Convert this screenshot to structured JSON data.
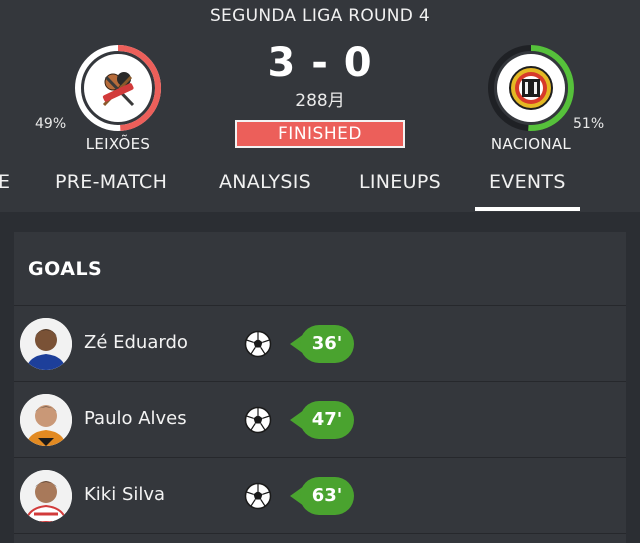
{
  "match": {
    "round": "SEGUNDA LIGA ROUND 4",
    "score": "3 - 0",
    "date": "288月",
    "status": "FINISHED"
  },
  "home": {
    "name": "LEIXÕES",
    "possession_label": "49%",
    "possession": 0.49,
    "ring_color": "#ec5f5a",
    "logo_icon": "leixoes-crest-icon"
  },
  "away": {
    "name": "NACIONAL",
    "possession_label": "51%",
    "possession": 0.51,
    "ring_color": "#56c13b",
    "logo_icon": "nacional-crest-icon"
  },
  "tabs": [
    {
      "label": "E"
    },
    {
      "label": "PRE-MATCH"
    },
    {
      "label": "ANALYSIS"
    },
    {
      "label": "LINEUPS"
    },
    {
      "label": "EVENTS",
      "active": true
    }
  ],
  "goals": {
    "title": "GOALS",
    "items": [
      {
        "player": "Zé Eduardo",
        "minute": "36'",
        "icon": "football-icon"
      },
      {
        "player": "Paulo Alves",
        "minute": "47'",
        "icon": "football-icon"
      },
      {
        "player": "Kiki Silva",
        "minute": "63'",
        "icon": "football-icon"
      }
    ]
  },
  "colors": {
    "background": "#2b2e33",
    "panel": "#34373c",
    "status": "#ec5f5a",
    "minute_badge": "#4aa32f"
  }
}
